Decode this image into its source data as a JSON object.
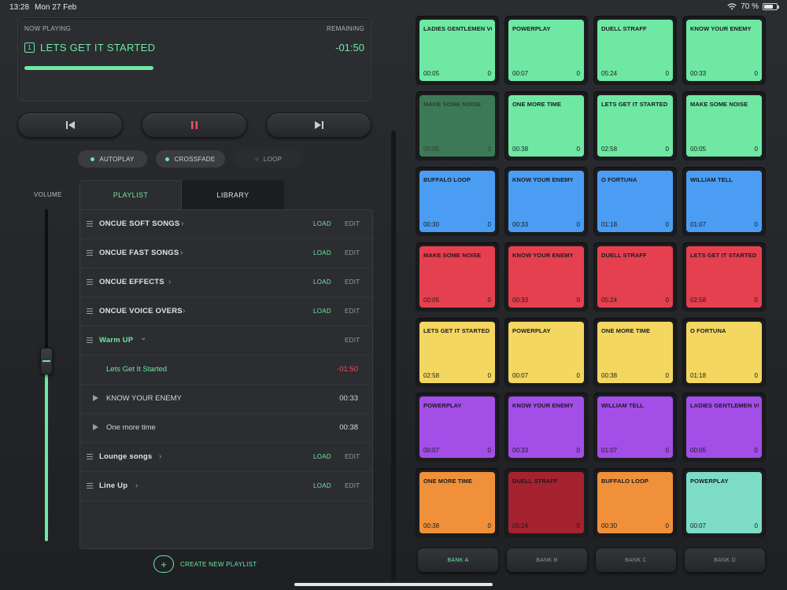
{
  "status": {
    "time": "13:28",
    "date": "Mon 27 Feb",
    "battery": "70 %",
    "battery_level": 0.7
  },
  "now_playing": {
    "label": "NOW PLAYING",
    "remaining_label": "REMAINING",
    "index": "1",
    "title": "LETS GET IT STARTED",
    "remaining": "-01:50",
    "progress": 0.38,
    "accent_color": "#6ee8a3"
  },
  "transport": {
    "prev_icon": "skip-back-icon",
    "pause_icon": "pause-icon",
    "next_icon": "skip-forward-icon"
  },
  "toggles": [
    {
      "label": "AUTOPLAY",
      "on": true
    },
    {
      "label": "CROSSFADE",
      "on": true
    },
    {
      "label": "LOOP",
      "on": false
    }
  ],
  "volume": {
    "label": "VOLUME",
    "level": 0.53
  },
  "tabs": [
    {
      "label": "PLAYLIST",
      "active": true
    },
    {
      "label": "LIBRARY",
      "active": false
    }
  ],
  "playlists": [
    {
      "name": "ONCUE SOFT SONGS",
      "load": "LOAD",
      "edit": "EDIT"
    },
    {
      "name": "ONCUE FAST SONGS",
      "load": "LOAD",
      "edit": "EDIT"
    },
    {
      "name": "ONCUE EFFECTS",
      "load": "LOAD",
      "edit": "EDIT"
    },
    {
      "name": "ONCUE VOICE OVERS",
      "load": "LOAD",
      "edit": "EDIT"
    },
    {
      "name": "Warm UP",
      "edit": "EDIT",
      "expanded": true,
      "tracks": [
        {
          "title": "Lets Get It Started",
          "duration": "-01:50",
          "current": true
        },
        {
          "title": "KNOW YOUR ENEMY",
          "duration": "00:33"
        },
        {
          "title": "One more time",
          "duration": "00:38"
        }
      ]
    },
    {
      "name": "Lounge songs",
      "load": "LOAD",
      "edit": "EDIT"
    },
    {
      "name": "Line Up",
      "load": "LOAD",
      "edit": "EDIT"
    }
  ],
  "create_playlist": {
    "icon": "plus-icon",
    "label": "CREATE NEW PLAYLIST"
  },
  "pads": [
    {
      "title": "LADIES  GENTLEMEN VO",
      "time": "00:05",
      "count": "0",
      "color": "#6ee8a3"
    },
    {
      "title": "POWERPLAY",
      "time": "00:07",
      "count": "0",
      "color": "#6ee8a3"
    },
    {
      "title": "DUELL STRAFF",
      "time": "05:24",
      "count": "0",
      "color": "#6ee8a3"
    },
    {
      "title": "KNOW YOUR ENEMY",
      "time": "00:33",
      "count": "0",
      "color": "#6ee8a3"
    },
    {
      "title": "MAKE SOME NOISE",
      "time": "00:05",
      "count": "3",
      "color": "#3c7a57",
      "dim": true
    },
    {
      "title": "ONE MORE TIME",
      "time": "00:38",
      "count": "0",
      "color": "#6ee8a3"
    },
    {
      "title": "LETS GET IT STARTED",
      "time": "02:58",
      "count": "0",
      "color": "#6ee8a3"
    },
    {
      "title": "MAKE SOME NOISE",
      "time": "00:05",
      "count": "0",
      "color": "#6ee8a3"
    },
    {
      "title": "BUFFALO LOOP",
      "time": "00:30",
      "count": "0",
      "color": "#4a9df2"
    },
    {
      "title": "KNOW YOUR ENEMY",
      "time": "00:33",
      "count": "0",
      "color": "#4a9df2"
    },
    {
      "title": "O FORTUNA",
      "time": "01:18",
      "count": "0",
      "color": "#4a9df2"
    },
    {
      "title": "WILLIAM TELL",
      "time": "01:07",
      "count": "0",
      "color": "#4a9df2"
    },
    {
      "title": "MAKE SOME NOISE",
      "time": "00:05",
      "count": "0",
      "color": "#e5404f"
    },
    {
      "title": "KNOW YOUR ENEMY",
      "time": "00:33",
      "count": "0",
      "color": "#e5404f"
    },
    {
      "title": "DUELL STRAFF",
      "time": "05:24",
      "count": "0",
      "color": "#e5404f"
    },
    {
      "title": "LETS GET IT STARTED",
      "time": "02:58",
      "count": "0",
      "color": "#e5404f"
    },
    {
      "title": "LETS GET IT STARTED",
      "time": "02:58",
      "count": "0",
      "color": "#f4d760"
    },
    {
      "title": "POWERPLAY",
      "time": "00:07",
      "count": "0",
      "color": "#f4d760"
    },
    {
      "title": "ONE MORE TIME",
      "time": "00:38",
      "count": "0",
      "color": "#f4d760"
    },
    {
      "title": "O FORTUNA",
      "time": "01:18",
      "count": "0",
      "color": "#f4d760"
    },
    {
      "title": "POWERPLAY",
      "time": "00:07",
      "count": "0",
      "color": "#a34ee6"
    },
    {
      "title": "KNOW YOUR ENEMY",
      "time": "00:33",
      "count": "0",
      "color": "#a34ee6"
    },
    {
      "title": "WILLIAM TELL",
      "time": "01:07",
      "count": "0",
      "color": "#a34ee6"
    },
    {
      "title": "LADIES  GENTLEMEN VO",
      "time": "00:05",
      "count": "0",
      "color": "#a34ee6"
    },
    {
      "title": "ONE MORE TIME",
      "time": "00:38",
      "count": "0",
      "color": "#f0903a"
    },
    {
      "title": "DUELL STRAFF",
      "time": "05:24",
      "count": "0",
      "color": "#a52231"
    },
    {
      "title": "BUFFALO LOOP",
      "time": "00:30",
      "count": "0",
      "color": "#f0903a"
    },
    {
      "title": "POWERPLAY",
      "time": "00:07",
      "count": "0",
      "color": "#7cdcc5"
    }
  ],
  "banks": [
    {
      "label": "BANK A",
      "active": true
    },
    {
      "label": "BANK B",
      "active": false
    },
    {
      "label": "BANK C",
      "active": false
    },
    {
      "label": "BANK D",
      "active": false
    }
  ]
}
